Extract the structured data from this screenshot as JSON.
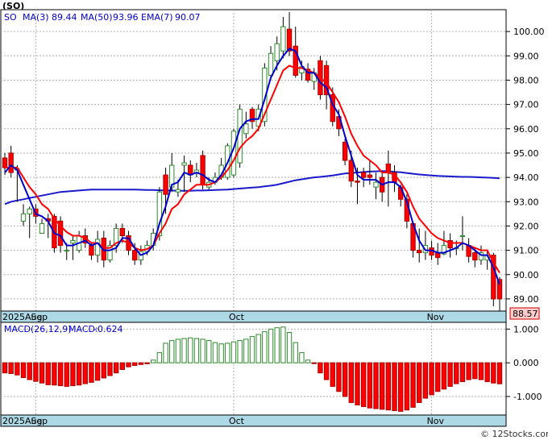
{
  "chart_data": {
    "type": "candlestick",
    "title": "(SO)",
    "ticker": "SO",
    "legend": {
      "ma3_label": "MA(3)",
      "ma3_value": "89.44",
      "ma50_label": "MA(50)",
      "ma50_value": "93.96",
      "ema7_label": "EMA(7)",
      "ema7_value": "90.07"
    },
    "price_axis": {
      "ylim": [
        88.5,
        100.9
      ],
      "ticks": [
        "89.00",
        "90.00",
        "91.00",
        "92.00",
        "93.00",
        "94.00",
        "95.00",
        "96.00",
        "97.00",
        "98.00",
        "99.00",
        "100.00"
      ]
    },
    "last_price": "88.57",
    "x_labels": [
      {
        "label": "2025Aug",
        "index": 0
      },
      {
        "label": "Sep",
        "index": 5
      },
      {
        "label": "Oct",
        "index": 37
      },
      {
        "label": "Nov",
        "index": 69
      }
    ],
    "candles": {
      "open": [
        94.8,
        95.0,
        94.3,
        92.2,
        92.5,
        92.7,
        91.7,
        92.3,
        92.4,
        92.2,
        91.0,
        91.3,
        91.0,
        91.6,
        91.2,
        90.8,
        91.5,
        90.6,
        91.2,
        91.9,
        91.6,
        91.0,
        90.6,
        90.95,
        91.2,
        91.6,
        94.1,
        93.6,
        93.4,
        94.5,
        94.5,
        94.2,
        94.9,
        93.6,
        93.8,
        94.0,
        94.0,
        94.1,
        94.6,
        95.8,
        96.8,
        96.1,
        96.3,
        98.2,
        98.8,
        99.2,
        100.1,
        99.4,
        98.3,
        98.45,
        97.95,
        98.8,
        98.6,
        97.4,
        96.5,
        95.45,
        94.7,
        93.85,
        94.2,
        94.1,
        93.6,
        94.0,
        94.55,
        94.2,
        93.6,
        93.1,
        92.1,
        91.0,
        90.9,
        91.1,
        90.9,
        90.85,
        91.4,
        91.1,
        91.6,
        91.2,
        90.9,
        90.6,
        90.6,
        90.8,
        89.8
      ],
      "close": [
        94.4,
        94.2,
        94.35,
        92.5,
        92.7,
        92.4,
        92.1,
        92.2,
        91.1,
        91.2,
        91.0,
        91.4,
        91.6,
        91.3,
        90.8,
        91.45,
        90.6,
        91.2,
        91.9,
        91.6,
        91.0,
        90.6,
        90.95,
        91.2,
        91.7,
        93.4,
        93.3,
        94.5,
        93.5,
        94.6,
        94.1,
        94.3,
        93.7,
        93.8,
        94.0,
        94.5,
        95.3,
        95.9,
        96.8,
        96.2,
        96.3,
        96.8,
        98.5,
        99.1,
        99.5,
        100.2,
        99.2,
        98.2,
        98.55,
        98.0,
        98.3,
        97.4,
        97.4,
        96.3,
        96.0,
        94.7,
        93.85,
        93.8,
        94.0,
        94.0,
        93.8,
        93.4,
        94.2,
        93.8,
        93.1,
        92.2,
        91.0,
        90.9,
        91.2,
        90.8,
        90.7,
        91.2,
        91.1,
        91.1,
        91.6,
        90.75,
        90.6,
        90.9,
        90.8,
        89.0,
        89.0
      ],
      "high": [
        95.0,
        95.3,
        94.5,
        92.9,
        92.8,
        92.9,
        92.3,
        92.5,
        92.5,
        92.4,
        91.3,
        91.6,
        91.8,
        91.9,
        91.3,
        91.8,
        91.8,
        91.4,
        92.1,
        92.1,
        91.8,
        91.3,
        91.2,
        91.4,
        91.9,
        93.6,
        94.4,
        95.0,
        93.9,
        94.9,
        94.7,
        94.6,
        95.1,
        94.0,
        94.2,
        94.8,
        95.4,
        96.0,
        97.0,
        96.7,
        96.9,
        97.0,
        98.7,
        99.4,
        99.8,
        100.6,
        100.8,
        100.2,
        98.8,
        98.7,
        98.5,
        99.0,
        98.8,
        97.7,
        96.8,
        95.6,
        95.1,
        94.4,
        94.4,
        94.7,
        94.2,
        94.2,
        95.1,
        94.5,
        93.7,
        93.3,
        92.2,
        91.9,
        91.8,
        91.4,
        91.3,
        91.8,
        91.7,
        91.4,
        92.4,
        91.5,
        91.1,
        91.2,
        91.0,
        90.9,
        89.9
      ],
      "low": [
        94.1,
        94.0,
        93.0,
        92.0,
        91.5,
        92.1,
        91.8,
        91.5,
        90.9,
        90.9,
        90.6,
        90.6,
        90.9,
        91.1,
        90.6,
        90.5,
        90.3,
        90.5,
        90.9,
        91.3,
        90.8,
        90.4,
        90.4,
        90.8,
        91.0,
        91.4,
        92.5,
        93.4,
        93.2,
        93.4,
        93.8,
        94.0,
        93.5,
        93.5,
        93.7,
        93.9,
        93.9,
        94.0,
        94.4,
        95.6,
        96.0,
        95.9,
        96.1,
        98.0,
        98.4,
        98.9,
        99.0,
        98.1,
        98.0,
        97.9,
        97.6,
        97.2,
        96.8,
        96.1,
        95.7,
        94.5,
        93.6,
        92.9,
        93.6,
        93.7,
        93.1,
        93.0,
        92.8,
        93.4,
        92.8,
        91.9,
        90.7,
        90.5,
        90.6,
        90.6,
        90.4,
        90.8,
        90.7,
        90.8,
        91.0,
        90.5,
        90.3,
        90.4,
        90.2,
        88.7,
        88.5
      ]
    },
    "ma3": [
      94.2,
      94.5,
      94.3,
      93.7,
      93.1,
      92.5,
      92.4,
      92.2,
      91.7,
      91.6,
      91.2,
      91.2,
      91.3,
      91.4,
      91.2,
      91.3,
      91.0,
      91.0,
      91.1,
      91.5,
      91.5,
      91.1,
      90.8,
      90.9,
      91.2,
      92.1,
      92.8,
      93.7,
      93.8,
      94.2,
      94.1,
      94.2,
      94.1,
      93.9,
      93.8,
      94.1,
      94.6,
      95.2,
      96.0,
      96.3,
      96.4,
      96.4,
      97.2,
      98.1,
      98.6,
      99.0,
      99.3,
      99.2,
      98.6,
      98.3,
      98.3,
      97.9,
      97.7,
      97.0,
      96.6,
      95.7,
      94.9,
      94.1,
      93.9,
      93.9,
      93.9,
      93.7,
      93.8,
      93.8,
      93.6,
      93.0,
      92.1,
      91.4,
      91.0,
      91.0,
      90.9,
      90.9,
      91.0,
      91.1,
      91.3,
      91.2,
      91.0,
      90.8,
      90.8,
      90.3,
      89.6
    ],
    "ema7": [
      94.4,
      94.4,
      94.4,
      94.0,
      93.6,
      93.3,
      92.9,
      92.7,
      92.3,
      92.0,
      91.75,
      91.6,
      91.6,
      91.5,
      91.3,
      91.3,
      91.1,
      91.1,
      91.3,
      91.4,
      91.3,
      91.1,
      91.0,
      91.05,
      91.2,
      91.7,
      92.1,
      92.7,
      92.9,
      93.3,
      93.5,
      93.7,
      93.7,
      93.7,
      93.8,
      94.0,
      94.3,
      94.7,
      95.2,
      95.5,
      95.7,
      96.0,
      96.6,
      97.2,
      97.8,
      98.4,
      98.6,
      98.5,
      98.5,
      98.4,
      98.3,
      98.1,
      97.9,
      97.5,
      97.1,
      96.5,
      95.8,
      95.3,
      94.9,
      94.7,
      94.5,
      94.2,
      94.2,
      94.1,
      93.8,
      93.4,
      92.8,
      92.3,
      92.0,
      91.7,
      91.5,
      91.4,
      91.3,
      91.3,
      91.3,
      91.2,
      91.1,
      91.0,
      91.0,
      90.5,
      90.07
    ],
    "ma50": [
      92.9,
      93.0,
      93.05,
      93.1,
      93.15,
      93.2,
      93.25,
      93.3,
      93.35,
      93.4,
      93.42,
      93.44,
      93.46,
      93.48,
      93.5,
      93.5,
      93.5,
      93.5,
      93.5,
      93.5,
      93.5,
      93.5,
      93.49,
      93.48,
      93.48,
      93.47,
      93.46,
      93.46,
      93.45,
      93.45,
      93.45,
      93.46,
      93.46,
      93.47,
      93.48,
      93.49,
      93.5,
      93.52,
      93.54,
      93.56,
      93.58,
      93.6,
      93.63,
      93.66,
      93.7,
      93.76,
      93.82,
      93.88,
      93.92,
      93.96,
      94.0,
      94.02,
      94.05,
      94.08,
      94.12,
      94.16,
      94.18,
      94.2,
      94.22,
      94.24,
      94.25,
      94.26,
      94.25,
      94.23,
      94.21,
      94.18,
      94.15,
      94.12,
      94.1,
      94.08,
      94.06,
      94.05,
      94.04,
      94.03,
      94.02,
      94.02,
      94.01,
      94.0,
      93.99,
      93.98,
      93.96
    ],
    "macd_axis": {
      "ylim": [
        -1.55,
        1.2
      ],
      "ticks": [
        "1.000",
        "0.000",
        "-1.000"
      ]
    },
    "macd_legend": {
      "label": "MACD(26,12,9)",
      "value_label": "MACD:",
      "value": "-0.624"
    },
    "macd_hist": [
      -0.3,
      -0.32,
      -0.36,
      -0.44,
      -0.5,
      -0.55,
      -0.6,
      -0.65,
      -0.66,
      -0.68,
      -0.7,
      -0.68,
      -0.66,
      -0.62,
      -0.58,
      -0.52,
      -0.45,
      -0.38,
      -0.3,
      -0.2,
      -0.12,
      -0.08,
      -0.05,
      -0.03,
      0.08,
      0.3,
      0.58,
      0.66,
      0.7,
      0.72,
      0.74,
      0.72,
      0.7,
      0.66,
      0.6,
      0.56,
      0.58,
      0.62,
      0.66,
      0.7,
      0.78,
      0.84,
      0.92,
      1.0,
      1.04,
      1.06,
      0.9,
      0.6,
      0.3,
      0.08,
      -0.02,
      -0.3,
      -0.5,
      -0.7,
      -0.85,
      -1.0,
      -1.18,
      -1.25,
      -1.3,
      -1.34,
      -1.36,
      -1.38,
      -1.4,
      -1.42,
      -1.44,
      -1.4,
      -1.32,
      -1.18,
      -1.05,
      -0.95,
      -0.85,
      -0.78,
      -0.7,
      -0.62,
      -0.56,
      -0.5,
      -0.47,
      -0.5,
      -0.56,
      -0.6,
      -0.624
    ],
    "x_axis_label_bottom": "2025Aug",
    "watermark": "© 12Stocks.com"
  },
  "colors": {
    "up_candle": "#2e8b2e",
    "down_candle": "#ff0000",
    "ma3_line": "#0000cc",
    "ema7_line": "#ff0000",
    "ma50_line": "#1a1acc",
    "macd_positive": "#2e8b2e",
    "macd_negative": "#ff0000",
    "date_band": "#add8e6",
    "last_price_box": "#ffcccc"
  }
}
